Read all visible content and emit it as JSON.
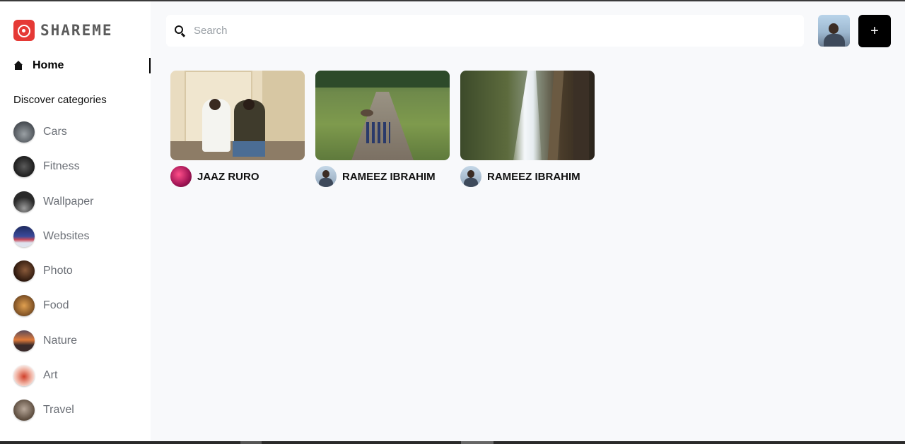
{
  "app": {
    "logo_text": "SHAREME",
    "brand_color": "#e53935"
  },
  "sidebar": {
    "home_label": "Home",
    "discover_label": "Discover categories",
    "categories": [
      {
        "label": "Cars",
        "thumb_color": "#6b6f74"
      },
      {
        "label": "Fitness",
        "thumb_color": "#2b2b2b"
      },
      {
        "label": "Wallpaper",
        "thumb_color": "#3a3a3a"
      },
      {
        "label": "Websites",
        "thumb_color": "#2e3b6e"
      },
      {
        "label": "Photo",
        "thumb_color": "#5a3a2a"
      },
      {
        "label": "Food",
        "thumb_color": "#b07a3c"
      },
      {
        "label": "Nature",
        "thumb_color": "#c8643a"
      },
      {
        "label": "Art",
        "thumb_color": "#e8c8c0"
      },
      {
        "label": "Travel",
        "thumb_color": "#7a6a5a"
      }
    ]
  },
  "header": {
    "search_placeholder": "Search",
    "add_label": "+"
  },
  "pins": [
    {
      "user": "JAAZ RURO"
    },
    {
      "user": "RAMEEZ IBRAHIM"
    },
    {
      "user": "RAMEEZ IBRAHIM"
    }
  ]
}
